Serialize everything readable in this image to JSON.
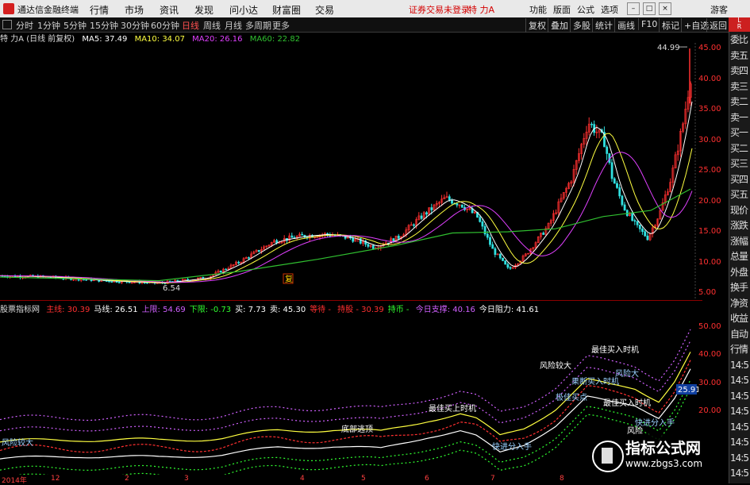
{
  "menubar": {
    "app_name": "通达信金融终端",
    "menus": [
      "行情",
      "市场",
      "资讯",
      "发现",
      "问小达",
      "财富圈",
      "交易"
    ],
    "notice": "证券交易未登录",
    "stock_label": "特 力A",
    "right_menus": [
      "功能",
      "版面",
      "公式",
      "选项"
    ],
    "guest": "游客"
  },
  "toolbar": {
    "periods": [
      "分时",
      "1分钟",
      "5分钟",
      "15分钟",
      "30分钟",
      "60分钟",
      "日线",
      "周线",
      "月线",
      "多周期",
      "更多"
    ],
    "active_period": "日线",
    "right_buttons": [
      "复权",
      "叠加",
      "多股",
      "统计",
      "画线",
      "F10",
      "标记",
      "+自选",
      "返回"
    ]
  },
  "main_chart": {
    "title": "特 力A (日线 前复权)",
    "ma5": "MA5: 37.49",
    "ma10": "MA10: 34.07",
    "ma20": "MA20: 26.16",
    "ma60": "MA60: 22.82",
    "high_label": "44.99",
    "low_label": "6.54",
    "marker_label": "复"
  },
  "indicator": {
    "name": "股票指标网",
    "items": [
      {
        "label": "主线:",
        "value": "30.39",
        "color": "#ff3030"
      },
      {
        "label": "马线:",
        "value": "26.51",
        "color": "#ffffff"
      },
      {
        "label": "上限:",
        "value": "54.69",
        "color": "#d060ff"
      },
      {
        "label": "下限:",
        "value": "-0.73",
        "color": "#30ff30"
      },
      {
        "label": "买:",
        "value": "7.73",
        "color": "#ffffff"
      },
      {
        "label": "卖:",
        "value": "45.30",
        "color": "#ffffff"
      },
      {
        "label": "等待 -",
        "value": "",
        "color": "#ff3030"
      },
      {
        "label": "持股 -",
        "value": "30.39",
        "color": "#ff3030"
      },
      {
        "label": "持币 -",
        "value": "",
        "color": "#30ff30"
      },
      {
        "label": "今日支撑:",
        "value": "40.16",
        "color": "#d060ff"
      },
      {
        "label": "今日阻力:",
        "value": "41.61",
        "color": "#ffffff"
      }
    ],
    "annotations": [
      "风险较大",
      "最佳买上时机",
      "极佳买点",
      "风险较大",
      "果断买入时机",
      "底部逃顶",
      "风险大",
      "最佳买入时机",
      "快进分入手",
      "最佳买入时机",
      "快进分入手",
      "风险"
    ],
    "value_box": "25.91"
  },
  "y_axis_main": [
    "45.00",
    "40.00",
    "35.00",
    "30.00",
    "25.00",
    "20.00",
    "15.00",
    "10.00",
    "5.00"
  ],
  "y_axis_ind": [
    "50.00",
    "40.00",
    "30.00",
    "20.00"
  ],
  "x_axis": [
    "2014年",
    "12",
    "2",
    "3",
    "4",
    "5",
    "6",
    "7",
    "8"
  ],
  "right_panel": {
    "top_label": "L\nR",
    "items": [
      "委比",
      "卖五",
      "卖四",
      "卖三",
      "卖二",
      "卖一",
      "买一",
      "买二",
      "买三",
      "买四",
      "买五",
      "现价",
      "涨跌",
      "涨幅",
      "总量",
      "外盘",
      "换手",
      "净资",
      "收益",
      "自动",
      "行情",
      "14:5",
      "14:5",
      "14:5",
      "14:5",
      "14:5",
      "14:5",
      "14:5",
      "14:5"
    ]
  },
  "watermark": {
    "title": "指标公式网",
    "url": "www.zbgs3.com"
  },
  "colors": {
    "up": "#ff3030",
    "down": "#30e0e0",
    "ma5": "#ffffff",
    "ma10": "#ffff40",
    "ma20": "#e040ff",
    "ma60": "#30c030"
  }
}
